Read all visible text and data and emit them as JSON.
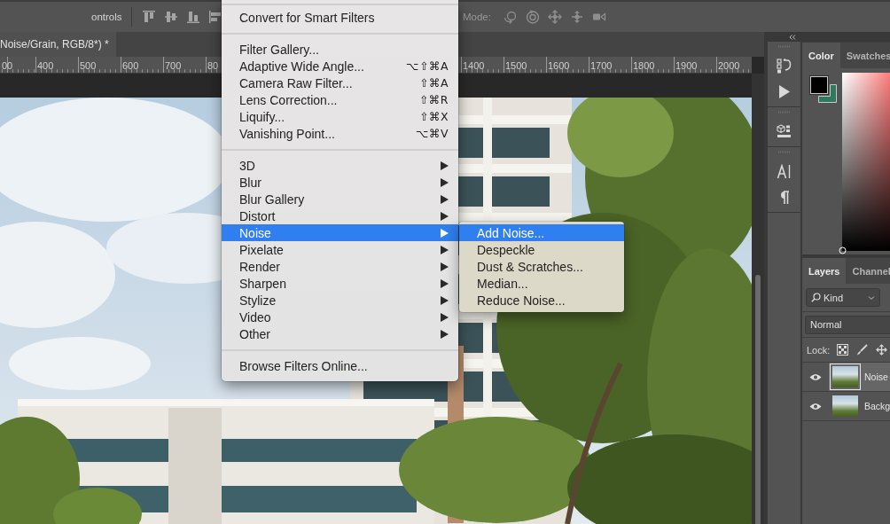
{
  "options_bar": {
    "controls_label": "ontrols",
    "mode_label": "Mode:"
  },
  "document_tab": {
    "title": "Noise/Grain, RGB/8*) *"
  },
  "ruler": {
    "left_labels": [
      "00",
      "400",
      "500",
      "600",
      "700",
      "80"
    ],
    "right_labels": [
      "1400",
      "1500",
      "1600",
      "1700",
      "1800",
      "1900",
      "2000"
    ]
  },
  "filter_menu": {
    "items": [
      {
        "kind": "separator"
      },
      {
        "kind": "item",
        "label": "Convert for Smart Filters",
        "submenu": false,
        "selected": false
      },
      {
        "kind": "separator"
      },
      {
        "kind": "item",
        "label": "Filter Gallery...",
        "submenu": false,
        "selected": false
      },
      {
        "kind": "item",
        "label": "Adaptive Wide Angle...",
        "shortcut": "⌥⇧⌘A",
        "submenu": false,
        "selected": false
      },
      {
        "kind": "item",
        "label": "Camera Raw Filter...",
        "shortcut": "⇧⌘A",
        "submenu": false,
        "selected": false
      },
      {
        "kind": "item",
        "label": "Lens Correction...",
        "shortcut": "⇧⌘R",
        "submenu": false,
        "selected": false
      },
      {
        "kind": "item",
        "label": "Liquify...",
        "shortcut": "⇧⌘X",
        "submenu": false,
        "selected": false
      },
      {
        "kind": "item",
        "label": "Vanishing Point...",
        "shortcut": "⌥⌘V",
        "submenu": false,
        "selected": false
      },
      {
        "kind": "separator"
      },
      {
        "kind": "item",
        "label": "3D",
        "submenu": true,
        "selected": false
      },
      {
        "kind": "item",
        "label": "Blur",
        "submenu": true,
        "selected": false
      },
      {
        "kind": "item",
        "label": "Blur Gallery",
        "submenu": true,
        "selected": false
      },
      {
        "kind": "item",
        "label": "Distort",
        "submenu": true,
        "selected": false
      },
      {
        "kind": "item",
        "label": "Noise",
        "submenu": true,
        "selected": true,
        "children": [
          {
            "label": "Add Noise...",
            "selected": true
          },
          {
            "label": "Despeckle",
            "selected": false
          },
          {
            "label": "Dust & Scratches...",
            "selected": false
          },
          {
            "label": "Median...",
            "selected": false
          },
          {
            "label": "Reduce Noise...",
            "selected": false
          }
        ]
      },
      {
        "kind": "item",
        "label": "Pixelate",
        "submenu": true,
        "selected": false
      },
      {
        "kind": "item",
        "label": "Render",
        "submenu": true,
        "selected": false
      },
      {
        "kind": "item",
        "label": "Sharpen",
        "submenu": true,
        "selected": false
      },
      {
        "kind": "item",
        "label": "Stylize",
        "submenu": true,
        "selected": false
      },
      {
        "kind": "item",
        "label": "Video",
        "submenu": true,
        "selected": false
      },
      {
        "kind": "item",
        "label": "Other",
        "submenu": true,
        "selected": false
      },
      {
        "kind": "separator"
      },
      {
        "kind": "item",
        "label": "Browse Filters Online...",
        "submenu": false,
        "selected": false
      }
    ]
  },
  "color_panel": {
    "tabs": [
      {
        "label": "Color",
        "selected": true
      },
      {
        "label": "Swatches",
        "selected": false
      }
    ],
    "swatches": [
      {
        "kind": "foreground",
        "color": "#000000"
      },
      {
        "kind": "background",
        "color": "#2e7a5f"
      }
    ]
  },
  "layers_panel": {
    "tabs": [
      {
        "label": "Layers",
        "selected": true
      },
      {
        "label": "Channel",
        "selected": false
      }
    ],
    "filter": {
      "value": "Kind"
    },
    "blend_mode": {
      "value": "Normal"
    },
    "lock_label": "Lock:",
    "layers": [
      {
        "name": "Noise",
        "visible": true,
        "selected": true
      },
      {
        "name": "Backg",
        "visible": true,
        "selected": false
      }
    ]
  }
}
